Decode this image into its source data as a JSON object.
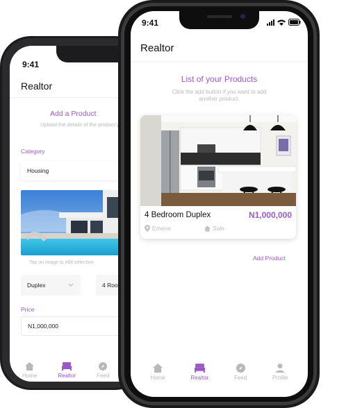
{
  "back_phone": {
    "status_time": "9:41",
    "header_title": "Realtor",
    "section_title": "Add a Product",
    "section_subtitle": "Upload the details of the product you want to sell",
    "category_label": "Category",
    "category_value": "Housing",
    "image_hint": "Tap on image to edit selection",
    "type_select_value": "Duplex",
    "rooms_select_value": "4 Rooms",
    "price_label": "Price",
    "price_value": "N1,000,000",
    "nav": [
      {
        "label": "Home",
        "icon": "home-icon"
      },
      {
        "label": "Realtor",
        "icon": "bed-icon",
        "active": true
      },
      {
        "label": "Feed",
        "icon": "compass-icon"
      }
    ]
  },
  "front_phone": {
    "status_time": "9:41",
    "header_title": "Realtor",
    "section_title": "List of your Products",
    "section_subtitle_line1": "Click the add button if you want to add",
    "section_subtitle_line2": "another product.",
    "product": {
      "name": "4 Bedroom Duplex",
      "price": "N1,000,000",
      "location": "Emene",
      "status": "Sale"
    },
    "add_link": "Add Product",
    "nav": [
      {
        "label": "Home",
        "icon": "home-icon"
      },
      {
        "label": "Realtor",
        "icon": "bed-icon",
        "active": true
      },
      {
        "label": "Feed",
        "icon": "compass-icon"
      },
      {
        "label": "Profile",
        "icon": "user-icon"
      }
    ]
  },
  "colors": {
    "accent": "#9b59c8",
    "muted": "#b8b8b8",
    "frame": "#1a1a1a"
  }
}
